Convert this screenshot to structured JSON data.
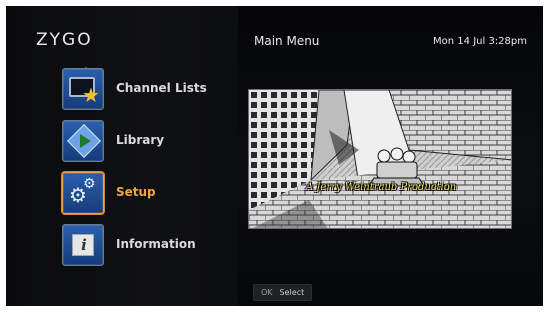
{
  "brand": {
    "logo_text": "ZYGO"
  },
  "header": {
    "title": "Main Menu",
    "datetime": "Mon 14 Jul 3:28pm"
  },
  "menu": {
    "items": [
      {
        "label": "Channel Lists",
        "icon": "tv-star-icon",
        "active": false
      },
      {
        "label": "Library",
        "icon": "library-play-icon",
        "active": false
      },
      {
        "label": "Setup",
        "icon": "gears-icon",
        "active": true
      },
      {
        "label": "Information",
        "icon": "info-icon",
        "active": false
      }
    ],
    "active_color": "#f4a23a"
  },
  "preview": {
    "caption": "A Jerry Weintraub Production"
  },
  "hint": {
    "key": "OK",
    "action": "Select"
  }
}
